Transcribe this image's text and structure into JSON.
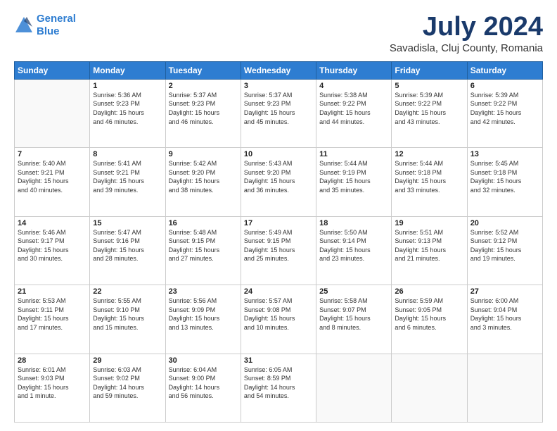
{
  "header": {
    "logo_line1": "General",
    "logo_line2": "Blue",
    "title": "July 2024",
    "subtitle": "Savadisla, Cluj County, Romania"
  },
  "weekdays": [
    "Sunday",
    "Monday",
    "Tuesday",
    "Wednesday",
    "Thursday",
    "Friday",
    "Saturday"
  ],
  "weeks": [
    [
      {
        "day": "",
        "info": ""
      },
      {
        "day": "1",
        "info": "Sunrise: 5:36 AM\nSunset: 9:23 PM\nDaylight: 15 hours\nand 46 minutes."
      },
      {
        "day": "2",
        "info": "Sunrise: 5:37 AM\nSunset: 9:23 PM\nDaylight: 15 hours\nand 46 minutes."
      },
      {
        "day": "3",
        "info": "Sunrise: 5:37 AM\nSunset: 9:23 PM\nDaylight: 15 hours\nand 45 minutes."
      },
      {
        "day": "4",
        "info": "Sunrise: 5:38 AM\nSunset: 9:22 PM\nDaylight: 15 hours\nand 44 minutes."
      },
      {
        "day": "5",
        "info": "Sunrise: 5:39 AM\nSunset: 9:22 PM\nDaylight: 15 hours\nand 43 minutes."
      },
      {
        "day": "6",
        "info": "Sunrise: 5:39 AM\nSunset: 9:22 PM\nDaylight: 15 hours\nand 42 minutes."
      }
    ],
    [
      {
        "day": "7",
        "info": "Sunrise: 5:40 AM\nSunset: 9:21 PM\nDaylight: 15 hours\nand 40 minutes."
      },
      {
        "day": "8",
        "info": "Sunrise: 5:41 AM\nSunset: 9:21 PM\nDaylight: 15 hours\nand 39 minutes."
      },
      {
        "day": "9",
        "info": "Sunrise: 5:42 AM\nSunset: 9:20 PM\nDaylight: 15 hours\nand 38 minutes."
      },
      {
        "day": "10",
        "info": "Sunrise: 5:43 AM\nSunset: 9:20 PM\nDaylight: 15 hours\nand 36 minutes."
      },
      {
        "day": "11",
        "info": "Sunrise: 5:44 AM\nSunset: 9:19 PM\nDaylight: 15 hours\nand 35 minutes."
      },
      {
        "day": "12",
        "info": "Sunrise: 5:44 AM\nSunset: 9:18 PM\nDaylight: 15 hours\nand 33 minutes."
      },
      {
        "day": "13",
        "info": "Sunrise: 5:45 AM\nSunset: 9:18 PM\nDaylight: 15 hours\nand 32 minutes."
      }
    ],
    [
      {
        "day": "14",
        "info": "Sunrise: 5:46 AM\nSunset: 9:17 PM\nDaylight: 15 hours\nand 30 minutes."
      },
      {
        "day": "15",
        "info": "Sunrise: 5:47 AM\nSunset: 9:16 PM\nDaylight: 15 hours\nand 28 minutes."
      },
      {
        "day": "16",
        "info": "Sunrise: 5:48 AM\nSunset: 9:15 PM\nDaylight: 15 hours\nand 27 minutes."
      },
      {
        "day": "17",
        "info": "Sunrise: 5:49 AM\nSunset: 9:15 PM\nDaylight: 15 hours\nand 25 minutes."
      },
      {
        "day": "18",
        "info": "Sunrise: 5:50 AM\nSunset: 9:14 PM\nDaylight: 15 hours\nand 23 minutes."
      },
      {
        "day": "19",
        "info": "Sunrise: 5:51 AM\nSunset: 9:13 PM\nDaylight: 15 hours\nand 21 minutes."
      },
      {
        "day": "20",
        "info": "Sunrise: 5:52 AM\nSunset: 9:12 PM\nDaylight: 15 hours\nand 19 minutes."
      }
    ],
    [
      {
        "day": "21",
        "info": "Sunrise: 5:53 AM\nSunset: 9:11 PM\nDaylight: 15 hours\nand 17 minutes."
      },
      {
        "day": "22",
        "info": "Sunrise: 5:55 AM\nSunset: 9:10 PM\nDaylight: 15 hours\nand 15 minutes."
      },
      {
        "day": "23",
        "info": "Sunrise: 5:56 AM\nSunset: 9:09 PM\nDaylight: 15 hours\nand 13 minutes."
      },
      {
        "day": "24",
        "info": "Sunrise: 5:57 AM\nSunset: 9:08 PM\nDaylight: 15 hours\nand 10 minutes."
      },
      {
        "day": "25",
        "info": "Sunrise: 5:58 AM\nSunset: 9:07 PM\nDaylight: 15 hours\nand 8 minutes."
      },
      {
        "day": "26",
        "info": "Sunrise: 5:59 AM\nSunset: 9:05 PM\nDaylight: 15 hours\nand 6 minutes."
      },
      {
        "day": "27",
        "info": "Sunrise: 6:00 AM\nSunset: 9:04 PM\nDaylight: 15 hours\nand 3 minutes."
      }
    ],
    [
      {
        "day": "28",
        "info": "Sunrise: 6:01 AM\nSunset: 9:03 PM\nDaylight: 15 hours\nand 1 minute."
      },
      {
        "day": "29",
        "info": "Sunrise: 6:03 AM\nSunset: 9:02 PM\nDaylight: 14 hours\nand 59 minutes."
      },
      {
        "day": "30",
        "info": "Sunrise: 6:04 AM\nSunset: 9:00 PM\nDaylight: 14 hours\nand 56 minutes."
      },
      {
        "day": "31",
        "info": "Sunrise: 6:05 AM\nSunset: 8:59 PM\nDaylight: 14 hours\nand 54 minutes."
      },
      {
        "day": "",
        "info": ""
      },
      {
        "day": "",
        "info": ""
      },
      {
        "day": "",
        "info": ""
      }
    ]
  ]
}
